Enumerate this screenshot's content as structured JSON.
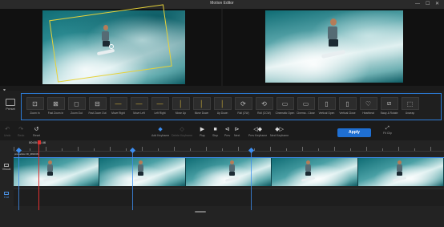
{
  "window": {
    "title": "Motion Editor",
    "controls": {
      "minimize": "—",
      "maximize": "☐",
      "close": "✕"
    }
  },
  "presets": {
    "side_label": "Preset",
    "items": [
      {
        "label": "Zoom In",
        "icon": "zoom-in-icon"
      },
      {
        "label": "Fast Zoom In",
        "icon": "fast-zoom-in-icon"
      },
      {
        "label": "Zoom Out",
        "icon": "zoom-out-icon"
      },
      {
        "label": "Fast Zoom Out",
        "icon": "fast-zoom-out-icon"
      },
      {
        "label": "Move Right",
        "icon": "move-right-icon"
      },
      {
        "label": "Move Left",
        "icon": "move-left-icon"
      },
      {
        "label": "Left Right",
        "icon": "left-right-icon"
      },
      {
        "label": "Move Up",
        "icon": "move-up-icon"
      },
      {
        "label": "Move Down",
        "icon": "move-down-icon"
      },
      {
        "label": "Up Down",
        "icon": "up-down-icon"
      },
      {
        "label": "Roll (CW)",
        "icon": "roll-cw-icon"
      },
      {
        "label": "Roll (CCW)",
        "icon": "roll-ccw-icon"
      },
      {
        "label": "Cinematic Open",
        "icon": "cinematic-open-icon"
      },
      {
        "label": "Cinema - Close",
        "icon": "cinema-close-icon"
      },
      {
        "label": "Vertical Open",
        "icon": "vertical-open-icon"
      },
      {
        "label": "Vertical Close",
        "icon": "vertical-close-icon"
      },
      {
        "label": "Heartbeat",
        "icon": "heartbeat-icon"
      },
      {
        "label": "Sway & Rotate",
        "icon": "sway-rotate-icon"
      },
      {
        "label": "Unwrap",
        "icon": "unwrap-icon"
      }
    ]
  },
  "toolbar": {
    "undo": "Undo",
    "redo": "Redo",
    "reset": "Reset",
    "add_keyframe": "Add Keyframe",
    "delete_keyframe": "Delete Keyframe",
    "play": "Play",
    "stop": "Stop",
    "prev": "Prev",
    "next": "Next",
    "prev_keyframe": "Prev Keyframe",
    "next_keyframe": "Next Keyframe",
    "apply": "Apply",
    "fit": "Fit Clip"
  },
  "timeline": {
    "timecode": "00:00:06.46",
    "clip_label": "production ID_4816361",
    "tracks": {
      "video": "Visual",
      "audio": "Cut"
    },
    "clip_count": 5,
    "keyframe_positions_pct": [
      1.2,
      27.5,
      55.2
    ]
  }
}
